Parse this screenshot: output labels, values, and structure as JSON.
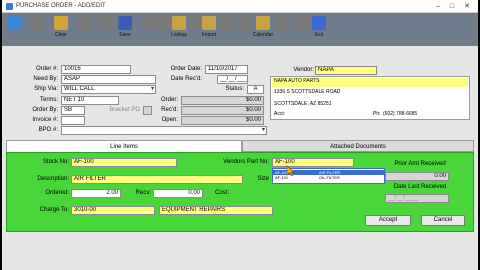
{
  "window": {
    "title": "PURCHASE ORDER - ADD/EDIT"
  },
  "toolbar": {
    "buttons": [
      {
        "id": "b0",
        "label": "",
        "color": "#3a88d8"
      },
      {
        "id": "b1",
        "label": "",
        "color": "#7a7a7a"
      },
      {
        "id": "b2",
        "label": "Clear",
        "color": "#d4a33a"
      },
      {
        "id": "b3",
        "label": "",
        "color": "#7a7a7a"
      },
      {
        "id": "b4",
        "label": "",
        "color": "#7a7a7a"
      },
      {
        "id": "b5",
        "label": "",
        "color": "#7a7a7a"
      },
      {
        "id": "b6",
        "label": "Save",
        "color": "#3b5fb0"
      },
      {
        "id": "b7",
        "label": "",
        "color": "#7a7a7a"
      },
      {
        "id": "b8",
        "label": "",
        "color": "#7a7a7a"
      },
      {
        "id": "b9",
        "label": "Lookup",
        "color": "#c9a243"
      },
      {
        "id": "b10",
        "label": "",
        "color": "#7a7a7a"
      },
      {
        "id": "b11",
        "label": "Import",
        "color": "#c9a243"
      },
      {
        "id": "b12",
        "label": "",
        "color": "#7a7a7a"
      },
      {
        "id": "b13",
        "label": "",
        "color": "#7a7a7a"
      },
      {
        "id": "b14",
        "label": "Calendar",
        "color": "#c9a243"
      },
      {
        "id": "b15",
        "label": "",
        "color": "#7a7a7a"
      },
      {
        "id": "b16",
        "label": "",
        "color": "#7a7a7a"
      },
      {
        "id": "b17",
        "label": "Exit",
        "color": "#3a6ad4"
      }
    ]
  },
  "header": {
    "order_no_label": "Order #:",
    "order_no": "10016",
    "need_by_label": "Need By:",
    "need_by": "ASAP",
    "ship_via_label": "Ship Via:",
    "ship_via": "WILL CALL",
    "terms_label": "Terms:",
    "terms": "NET 10",
    "order_by_label": "Order By:",
    "order_by": "SB",
    "bracket_po_label": "Bracket PO",
    "invoice_label": "Invoice #:",
    "invoice": "",
    "bpo_label": "BPO #:",
    "bpo": "",
    "order_date_label": "Order Date:",
    "order_date": "11/10/2017",
    "date_recd_label": "Date Rec'd:",
    "date_recd": "__/__/____",
    "status_label": "Status:",
    "status": "A",
    "order_amt_label": "Order:",
    "order_amt": "$0.00",
    "recd_amt_label": "Rec'd:",
    "recd_amt": "$0.00",
    "open_amt_label": "Open:",
    "open_amt": "$0.00"
  },
  "vendor": {
    "label": "Vendor:",
    "code": "NAPA",
    "name": "NAPA AUTO PARTS",
    "address1": "1336 S SCOTTSDALE ROAD",
    "city": "SCOTTSDALE, AZ  85251",
    "acct_label": "Acct:",
    "phone_label": "Ph:",
    "phone": "(602) 788-6685"
  },
  "tabs": {
    "line_items": "Line Items",
    "attached_docs": "Attached Documents"
  },
  "line_item": {
    "stock_no_label": "Stock No:",
    "stock_no": "AF-100",
    "vendors_part_label": "Vendors Part No:",
    "vendors_part": "AF-100",
    "description_label": "Description:",
    "description": "AIR FILTER",
    "size_label": "Size",
    "ordered_label": "Ordered:",
    "ordered": "2.00",
    "recv_label": "Recv:",
    "recv": "0.00",
    "cost_label": "Cost:",
    "charge_to_label": "Charge To:",
    "charge_to": "3010-00",
    "charge_desc": "EQUIPMENT REPAIRS",
    "prior_amt_label": "Prior Amt Received",
    "prior_amt": "0.00",
    "date_last_label": "Date Last Received",
    "date_last": "__/__/____"
  },
  "dropdown": {
    "rows": [
      {
        "code": "AF-100",
        "desc": "AIR FILTER"
      },
      {
        "code": "AF-101",
        "desc": "OIL FILTER"
      }
    ]
  },
  "buttons": {
    "accept": "Accept",
    "cancel": "Cancel"
  }
}
